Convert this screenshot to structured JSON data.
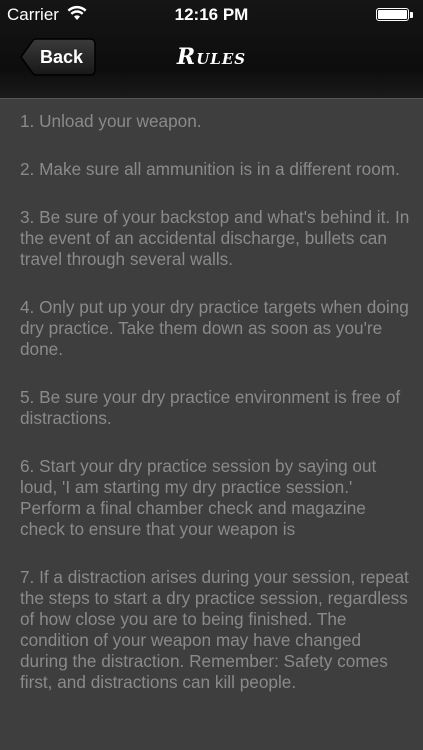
{
  "status_bar": {
    "carrier": "Carrier",
    "time": "12:16 PM",
    "wifi_icon": "wifi-icon",
    "battery_icon": "battery-icon"
  },
  "nav": {
    "back_label": "Back",
    "title": "Rules"
  },
  "rules": [
    "1. Unload your weapon.",
    "2. Make sure all ammunition is in a different room.",
    "3. Be sure of your backstop and what's behind it. In the event of an accidental discharge, bullets can travel through several walls.",
    "4. Only put up your dry practice targets when doing dry practice. Take them down as soon as you're done.",
    "5. Be sure your dry practice environment is free of distractions.",
    "6. Start your dry practice session by saying out loud, 'I am starting my dry practice session.' Perform a final chamber check and magazine check to ensure that your weapon is",
    "7. If a distraction arises during your session, repeat the steps to start a dry practice session, regardless of how close you are to being finished. The condition of your weapon may have changed during the distraction. Remember: Safety comes first, and distractions can kill people."
  ],
  "colors": {
    "background": "#3e3e3e",
    "bar": "#111111",
    "text": "#8a8a8a"
  }
}
